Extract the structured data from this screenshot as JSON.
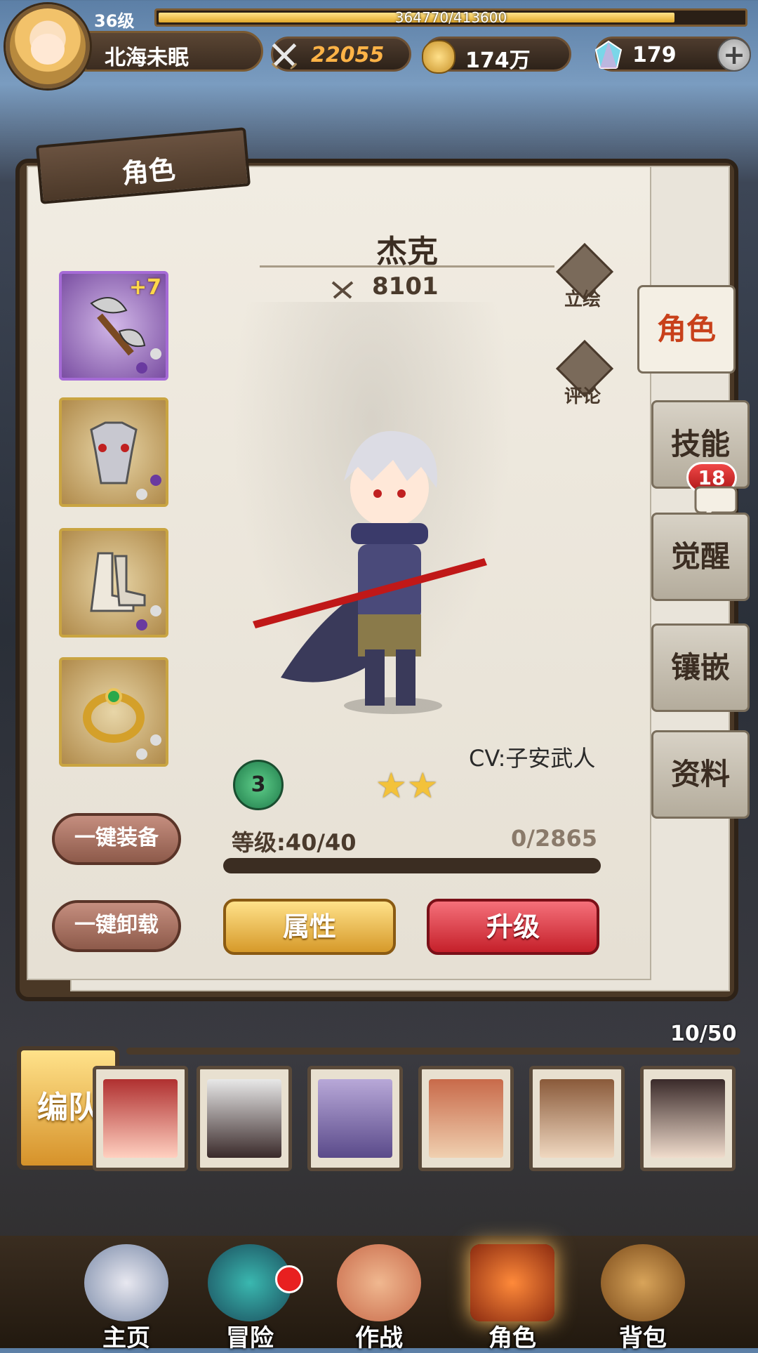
{
  "player": {
    "level": "36级",
    "xp": "364770/413600",
    "xp_fraction": 0.882,
    "name": "北海未眠"
  },
  "currencies": {
    "power": "22055",
    "gold": "174万",
    "gems": "179"
  },
  "panel": {
    "title": "角色"
  },
  "character": {
    "name": "杰克",
    "power": "8101",
    "cv": "CV:子安武人",
    "rank": "3",
    "stars": 2,
    "level_label": "等级:40/40",
    "exp": "0/2865",
    "exp_fraction": 0.0
  },
  "actions": {
    "portrait": "立绘",
    "comment": "评论",
    "equip_all": "一键装备",
    "unequip_all": "一键卸载",
    "attributes": "属性",
    "upgrade": "升级"
  },
  "equipment": [
    {
      "plus": "+7"
    }
  ],
  "tabs": [
    {
      "label": "角色"
    },
    {
      "label": "技能"
    },
    {
      "label": "觉醒"
    },
    {
      "label": "镶嵌"
    },
    {
      "label": "资料"
    }
  ],
  "skill_badge": "18",
  "roster": {
    "count": "10/50",
    "team_label": "编队"
  },
  "nav": [
    {
      "label": "主页"
    },
    {
      "label": "冒险"
    },
    {
      "label": "作战"
    },
    {
      "label": "角色"
    },
    {
      "label": "背包"
    }
  ],
  "colors": {
    "accent": "#c8401a",
    "gold": "#d69a2a",
    "red": "#c5202a"
  }
}
